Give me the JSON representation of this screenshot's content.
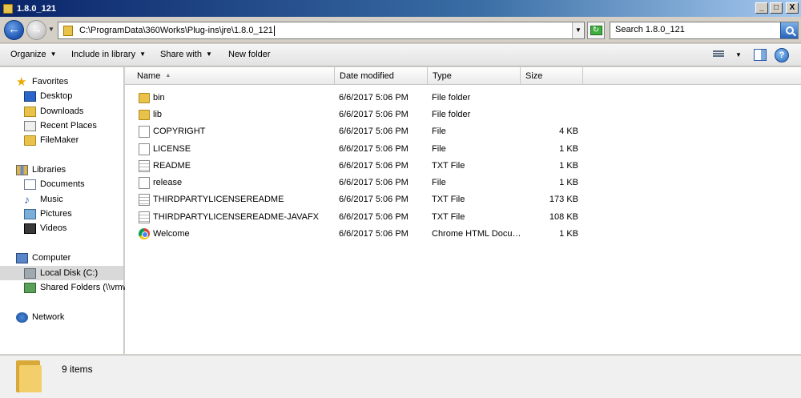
{
  "window": {
    "title": "1.8.0_121"
  },
  "window_buttons": {
    "minimize": "_",
    "maximize": "□",
    "close": "X"
  },
  "navigation": {
    "back_glyph": "←",
    "forward_glyph": "→",
    "address": "C:\\ProgramData\\360Works\\Plug-ins\\jre\\1.8.0_121",
    "search_placeholder": "Search 1.8.0_121"
  },
  "command_bar": {
    "organize": "Organize",
    "include_in_library": "Include in library",
    "share_with": "Share with",
    "new_folder": "New folder",
    "help": "?"
  },
  "sidebar": {
    "favorites": {
      "label": "Favorites",
      "items": [
        "Desktop",
        "Downloads",
        "Recent Places",
        "FileMaker"
      ]
    },
    "libraries": {
      "label": "Libraries",
      "items": [
        "Documents",
        "Music",
        "Pictures",
        "Videos"
      ]
    },
    "computer": {
      "label": "Computer",
      "items": [
        "Local Disk (C:)",
        "Shared Folders (\\\\vmw"
      ]
    },
    "network": {
      "label": "Network"
    }
  },
  "columns": {
    "name": "Name",
    "date": "Date modified",
    "type": "Type",
    "size": "Size"
  },
  "files": [
    {
      "icon": "folder-icon",
      "name": "bin",
      "date": "6/6/2017 5:06 PM",
      "type": "File folder",
      "size": ""
    },
    {
      "icon": "folder-icon",
      "name": "lib",
      "date": "6/6/2017 5:06 PM",
      "type": "File folder",
      "size": ""
    },
    {
      "icon": "file-icon",
      "name": "COPYRIGHT",
      "date": "6/6/2017 5:06 PM",
      "type": "File",
      "size": "4 KB"
    },
    {
      "icon": "file-icon",
      "name": "LICENSE",
      "date": "6/6/2017 5:06 PM",
      "type": "File",
      "size": "1 KB"
    },
    {
      "icon": "text-file-icon",
      "name": "README",
      "date": "6/6/2017 5:06 PM",
      "type": "TXT File",
      "size": "1 KB"
    },
    {
      "icon": "file-icon",
      "name": "release",
      "date": "6/6/2017 5:06 PM",
      "type": "File",
      "size": "1 KB"
    },
    {
      "icon": "text-file-icon",
      "name": "THIRDPARTYLICENSEREADME",
      "date": "6/6/2017 5:06 PM",
      "type": "TXT File",
      "size": "173 KB"
    },
    {
      "icon": "text-file-icon",
      "name": "THIRDPARTYLICENSEREADME-JAVAFX",
      "date": "6/6/2017 5:06 PM",
      "type": "TXT File",
      "size": "108 KB"
    },
    {
      "icon": "chrome-icon",
      "name": "Welcome",
      "date": "6/6/2017 5:06 PM",
      "type": "Chrome HTML Docu…",
      "size": "1 KB"
    }
  ],
  "status": {
    "item_count": "9 items"
  }
}
